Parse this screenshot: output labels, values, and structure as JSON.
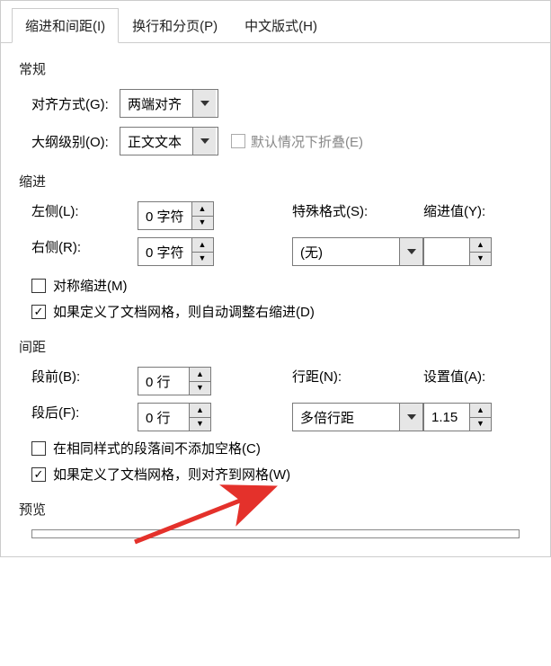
{
  "tabs": {
    "indent": "缩进和间距(I)",
    "pagination": "换行和分页(P)",
    "chinese": "中文版式(H)"
  },
  "general": {
    "title": "常规",
    "alignment_label": "对齐方式(G):",
    "alignment_value": "两端对齐",
    "outline_label": "大纲级别(O):",
    "outline_value": "正文文本",
    "collapse_label": "默认情况下折叠(E)"
  },
  "indent": {
    "title": "缩进",
    "left_label": "左侧(L):",
    "left_value": "0 字符",
    "right_label": "右侧(R):",
    "right_value": "0 字符",
    "special_label": "特殊格式(S):",
    "special_value": "(无)",
    "by_label": "缩进值(Y):",
    "by_value": "",
    "mirror_label": "对称缩进(M)",
    "grid_label": "如果定义了文档网格，则自动调整右缩进(D)"
  },
  "spacing": {
    "title": "间距",
    "before_label": "段前(B):",
    "before_value": "0 行",
    "after_label": "段后(F):",
    "after_value": "0 行",
    "line_label": "行距(N):",
    "line_value": "多倍行距",
    "at_label": "设置值(A):",
    "at_value": "1.15",
    "same_style_label": "在相同样式的段落间不添加空格(C)",
    "grid_label": "如果定义了文档网格，则对齐到网格(W)"
  },
  "preview": {
    "title": "预览"
  },
  "checks": {
    "indent_mirror": false,
    "indent_grid": true,
    "spacing_same": false,
    "spacing_grid": true,
    "collapse": false
  }
}
